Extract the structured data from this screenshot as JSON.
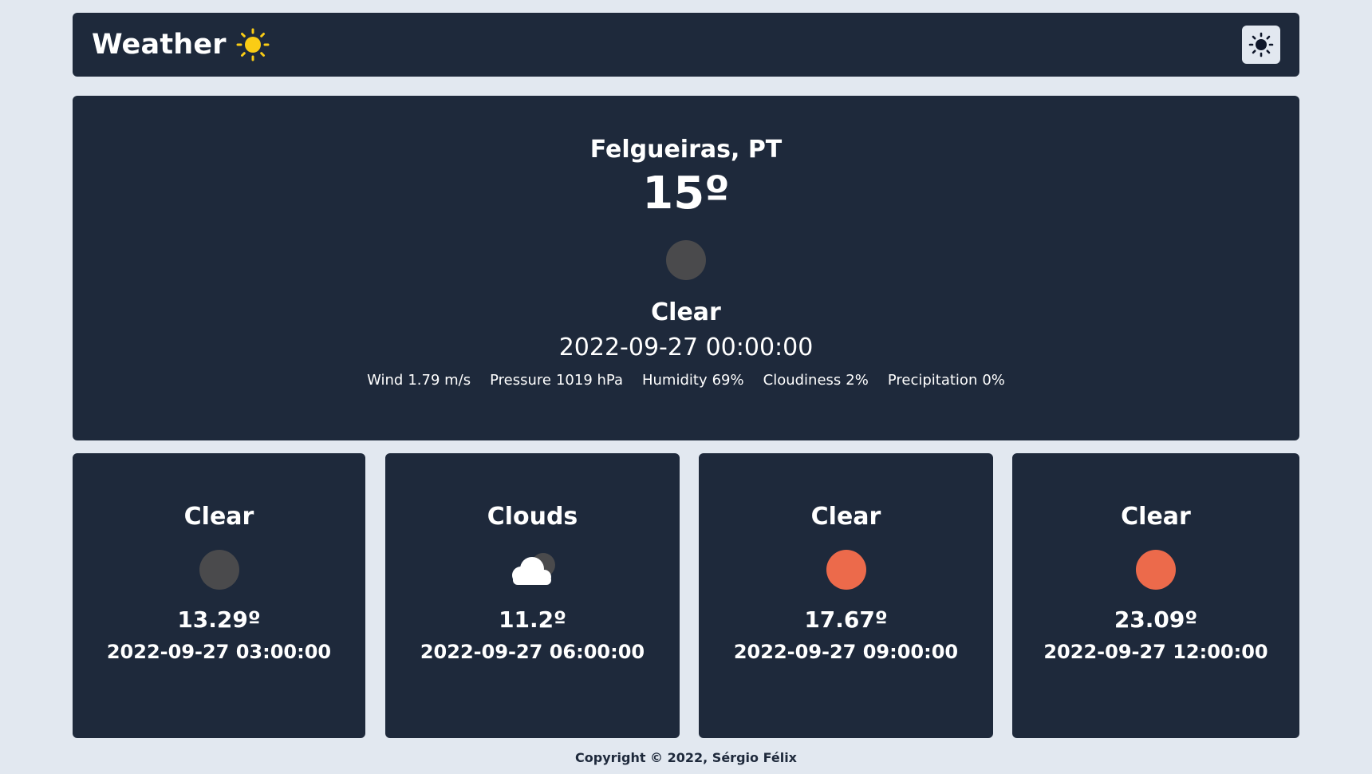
{
  "header": {
    "title": "Weather",
    "title_icon": "sun-icon",
    "theme_toggle_icon": "sun-icon"
  },
  "current": {
    "location": "Felgueiras, PT",
    "temperature": "15º",
    "icon": "moon-clear-night-icon",
    "condition": "Clear",
    "datetime": "2022-09-27 00:00:00",
    "stats": [
      {
        "label": "Wind",
        "value": "1.79 m/s"
      },
      {
        "label": "Pressure",
        "value": "1019 hPa"
      },
      {
        "label": "Humidity",
        "value": "69%"
      },
      {
        "label": "Cloudiness",
        "value": "2%"
      },
      {
        "label": "Precipitation",
        "value": "0%"
      }
    ]
  },
  "forecast": [
    {
      "condition": "Clear",
      "icon": "moon-clear-night-icon",
      "temperature": "13.29º",
      "datetime": "2022-09-27 03:00:00"
    },
    {
      "condition": "Clouds",
      "icon": "cloud-night-icon",
      "temperature": "11.2º",
      "datetime": "2022-09-27 06:00:00"
    },
    {
      "condition": "Clear",
      "icon": "sun-clear-day-icon",
      "temperature": "17.67º",
      "datetime": "2022-09-27 09:00:00"
    },
    {
      "condition": "Clear",
      "icon": "sun-clear-day-icon",
      "temperature": "23.09º",
      "datetime": "2022-09-27 12:00:00"
    }
  ],
  "footer": {
    "copyright": "Copyright © 2022, Sérgio Félix"
  },
  "colors": {
    "background": "#e2e8f0",
    "card": "#1e293b",
    "sun_yellow": "#facc15",
    "night_dot": "#4a4a4c",
    "day_dot": "#ec6a4b"
  }
}
